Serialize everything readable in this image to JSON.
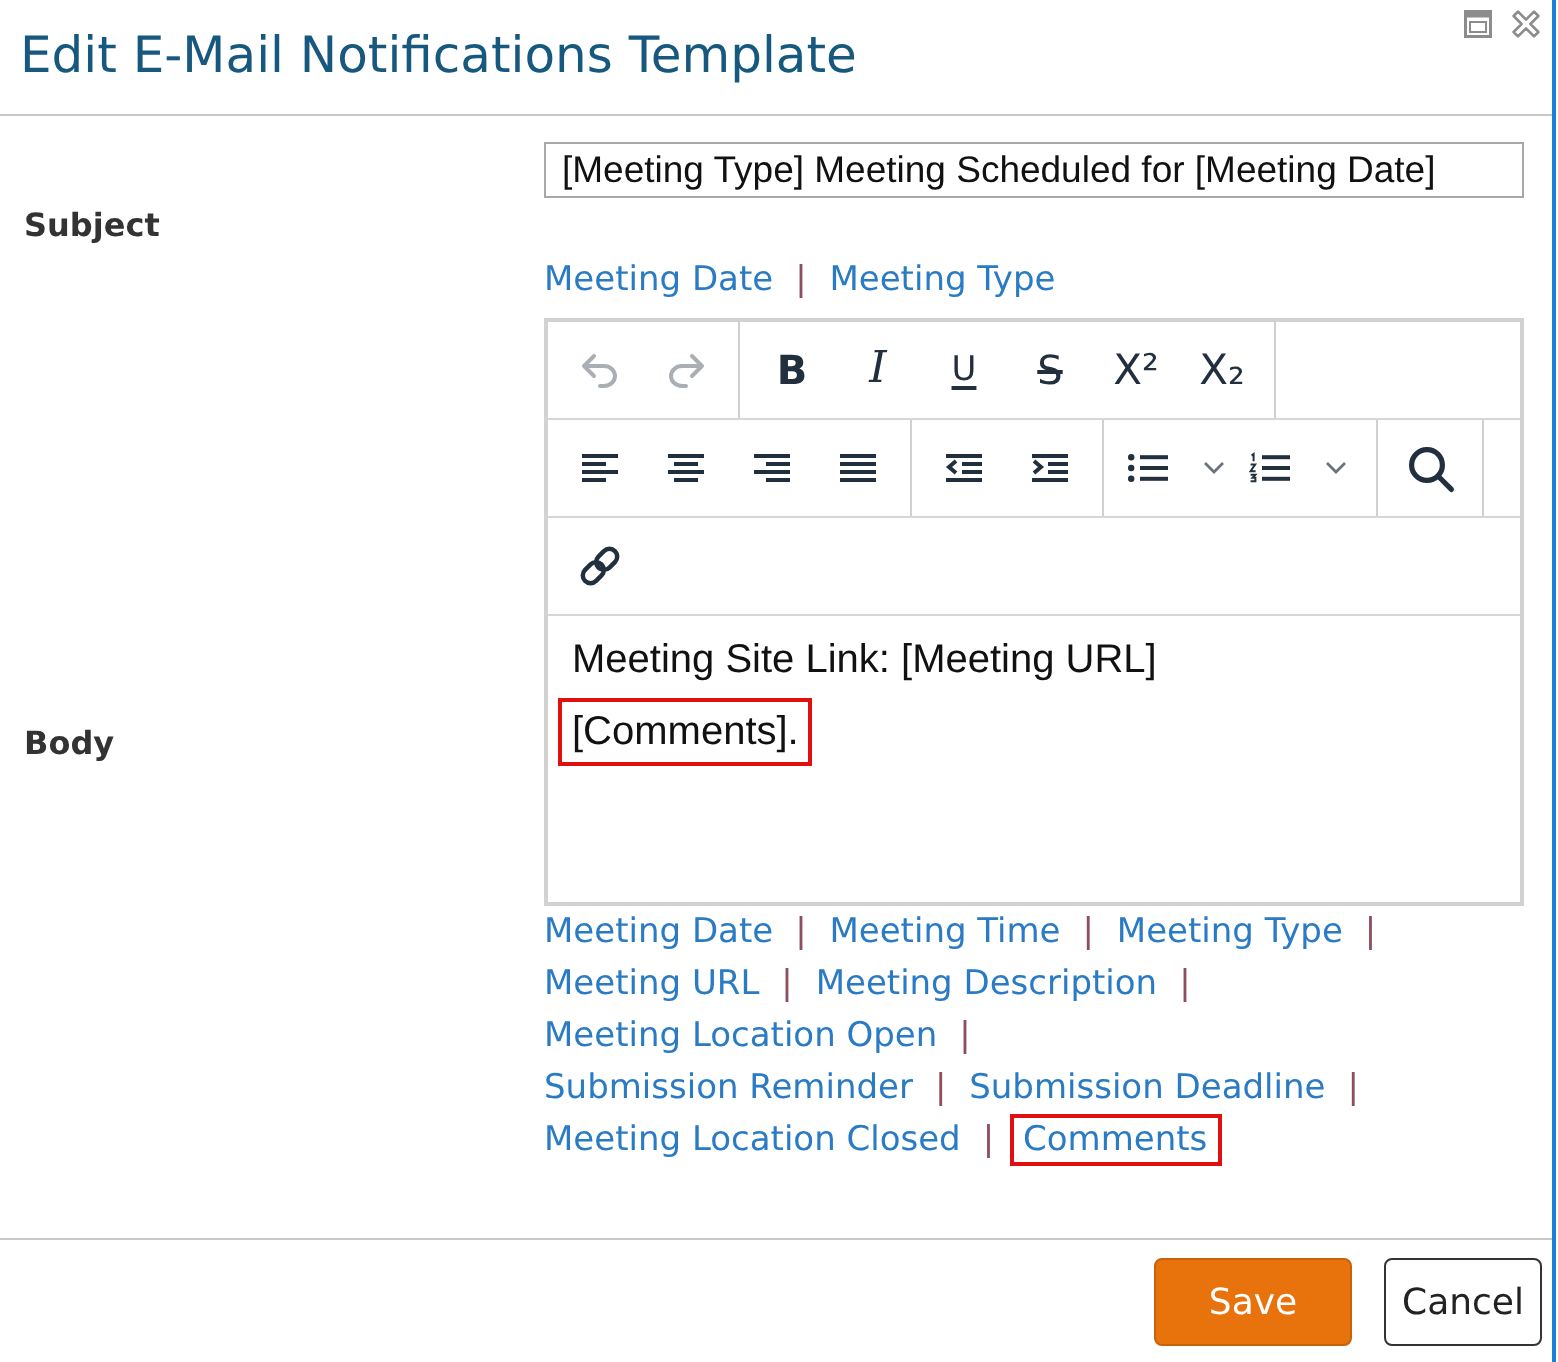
{
  "window": {
    "title": "Edit E-Mail Notifications Template"
  },
  "subject": {
    "label": "Subject",
    "value": "[Meeting Type] Meeting Scheduled for [Meeting Date]",
    "placeholders": [
      {
        "label": "Meeting Date",
        "separator": "|",
        "highlighted": false
      },
      {
        "label": "Meeting Type",
        "highlighted": false
      }
    ]
  },
  "body": {
    "label": "Body",
    "toolbar": [
      {
        "groups": [
          {
            "buttons": [
              {
                "kind": "undo",
                "disabled": true
              },
              {
                "kind": "redo",
                "disabled": true
              }
            ]
          },
          {
            "buttons": [
              {
                "kind": "bold",
                "glyph": "B",
                "disabled": false
              },
              {
                "kind": "italic",
                "glyph": "I",
                "disabled": false
              },
              {
                "kind": "underline",
                "glyph": "U",
                "disabled": false
              },
              {
                "kind": "strikethrough",
                "glyph": "S",
                "disabled": false
              },
              {
                "kind": "superscript",
                "glyph": "X²",
                "disabled": false
              },
              {
                "kind": "subscript",
                "glyph": "X₂",
                "disabled": false
              }
            ]
          }
        ]
      },
      {
        "groups": [
          {
            "buttons": [
              {
                "kind": "align_left",
                "disabled": false
              },
              {
                "kind": "align_center",
                "disabled": false
              },
              {
                "kind": "align_right",
                "disabled": false
              },
              {
                "kind": "justify",
                "disabled": false
              }
            ]
          },
          {
            "buttons": [
              {
                "kind": "outdent",
                "disabled": false
              },
              {
                "kind": "indent",
                "disabled": false
              }
            ]
          },
          {
            "buttons": [
              {
                "kind": "bullet_list",
                "disabled": false
              },
              {
                "kind": "numbered_list",
                "disabled": false
              }
            ]
          },
          {
            "buttons": [
              {
                "kind": "search",
                "disabled": false
              }
            ]
          }
        ]
      },
      {
        "groups": [
          {
            "buttons": [
              {
                "kind": "link",
                "disabled": false
              }
            ]
          }
        ]
      }
    ],
    "paragraphs": [
      {
        "text": "Meeting Site Link: [Meeting URL]",
        "highlighted": false
      },
      {
        "text": "[Comments].",
        "highlighted": true
      }
    ],
    "placeholder_groups": [
      {
        "items": [
          {
            "label": "Meeting Date",
            "separator": "|",
            "highlighted": false
          },
          {
            "label": "Meeting Time",
            "separator": "|",
            "highlighted": false
          },
          {
            "label": "Meeting Type",
            "separator": "|",
            "highlighted": false
          },
          {
            "label": "Meeting URL",
            "separator": "|",
            "highlighted": false
          },
          {
            "label": "Meeting Description",
            "separator": "|",
            "highlighted": false
          },
          {
            "label": "Meeting Location Open",
            "separator": "|",
            "highlighted": false
          }
        ]
      },
      {
        "items": [
          {
            "label": "Submission Reminder",
            "separator": "|",
            "highlighted": false
          },
          {
            "label": "Submission Deadline",
            "separator": "|",
            "highlighted": false
          },
          {
            "label": "Meeting Location Closed",
            "separator": "|",
            "highlighted": false
          },
          {
            "label": "Comments",
            "highlighted": true
          }
        ]
      }
    ]
  },
  "buttons": [
    {
      "label": "Save",
      "kind": "primary"
    },
    {
      "label": "Cancel",
      "kind": "secondary"
    }
  ]
}
